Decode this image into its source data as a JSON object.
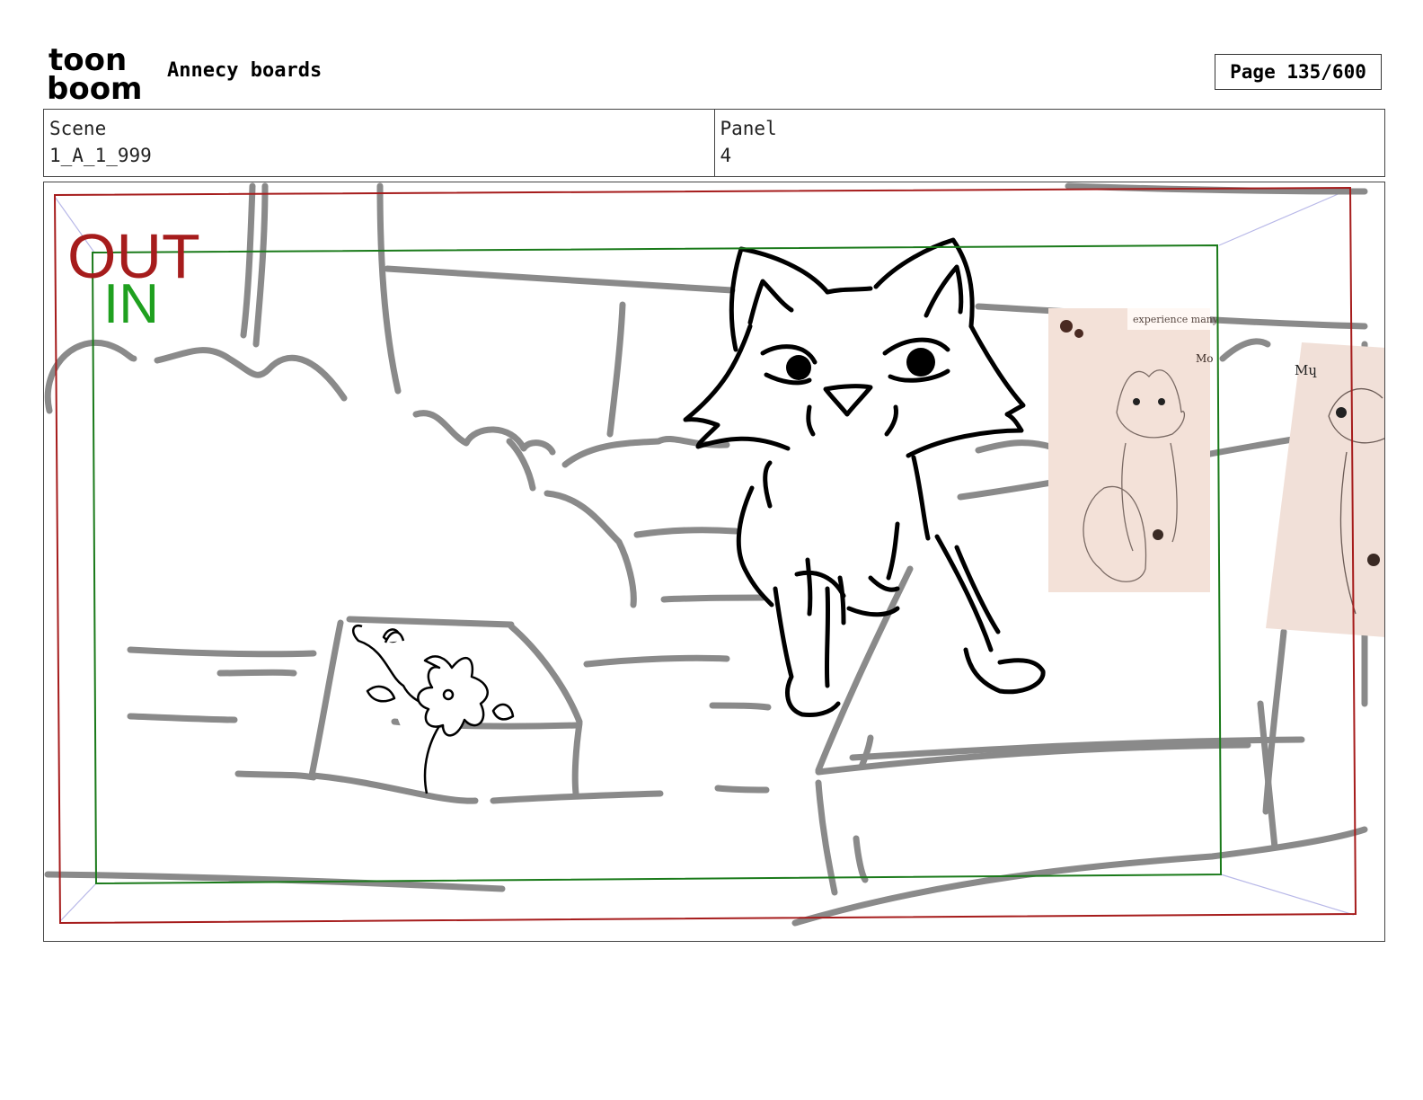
{
  "header": {
    "logo_top": "toon",
    "logo_bottom": "boom",
    "title": "Annecy boards",
    "page_label": "Page 135/600"
  },
  "info": {
    "scene_label": "Scene",
    "scene_value": "1_A_1_999",
    "panel_label": "Panel",
    "panel_value": "4"
  },
  "panel": {
    "safe_frame_labels": {
      "out": "OUT",
      "in": "IN"
    },
    "reference_card_text": {
      "line1": "experience many",
      "line2": "Mo"
    },
    "reference_card2_text": "Mɥ",
    "colors": {
      "out_frame": "#a61c1c",
      "in_frame": "#1a7a1a",
      "in_label": "#1fa01f",
      "sketch_gray": "#8a8a8a"
    }
  }
}
